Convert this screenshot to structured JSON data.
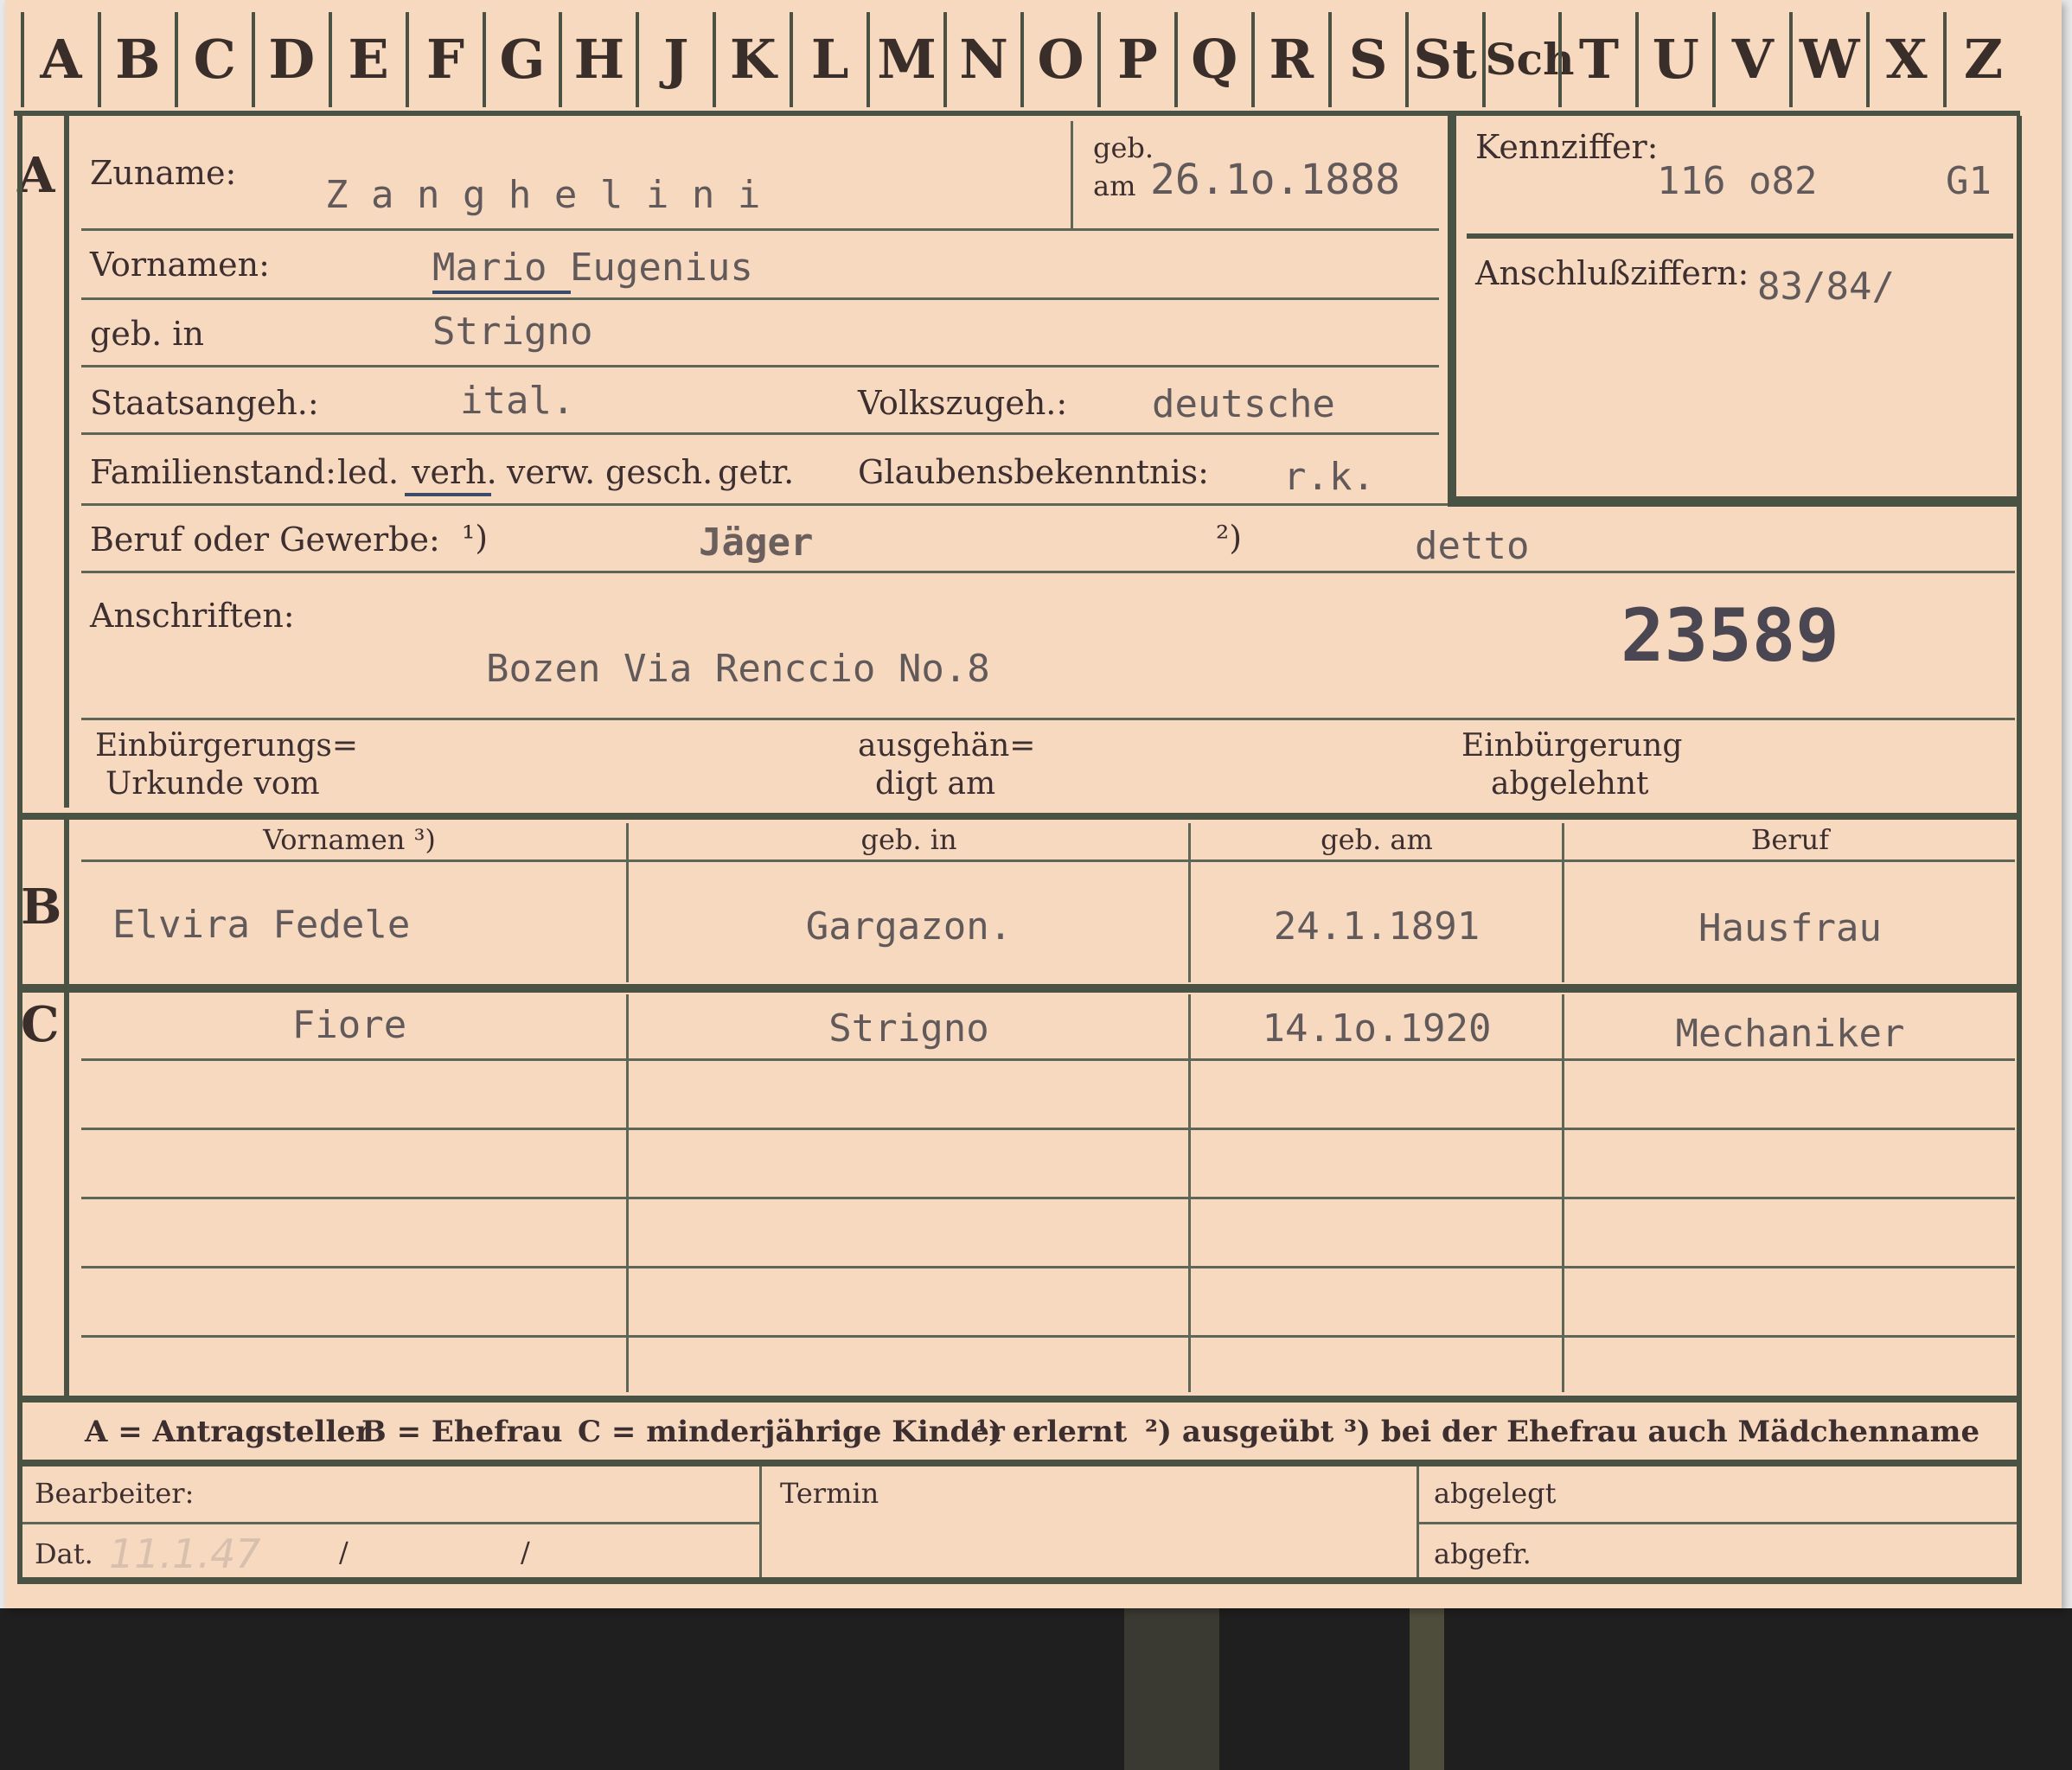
{
  "tabs": [
    "A",
    "B",
    "C",
    "D",
    "E",
    "F",
    "G",
    "H",
    "J",
    "K",
    "L",
    "M",
    "N",
    "O",
    "P",
    "Q",
    "R",
    "S",
    "St",
    "Sch",
    "T",
    "U",
    "V",
    "W",
    "X",
    "Z"
  ],
  "section_a": {
    "letter": "A",
    "zuname_label": "Zuname:",
    "zuname_value": "Z a n g h e l i n i",
    "geb_am_label_1": "geb.",
    "geb_am_label_2": "am",
    "geb_am_value": "26.1o.1888",
    "vornamen_label": "Vornamen:",
    "vornamen_value": "Mario Eugenius",
    "geb_in_label": "geb. in",
    "geb_in_value": "Strigno",
    "staatsangeh_label": "Staatsangeh.:",
    "staatsangeh_value": "ital.",
    "volkszugeh_label": "Volkszugeh.:",
    "volkszugeh_value": "deutsche",
    "familienstand_label": "Familienstand:",
    "familienstand_options": [
      "led.",
      "verh.",
      "verw.",
      "gesch.",
      "getr."
    ],
    "familienstand_selected": "verh.",
    "glaubensbekenntnis_label": "Glaubensbekenntnis:",
    "glaubensbekenntnis_value": "r.k.",
    "kennziffer_label": "Kennziffer:",
    "kennziffer_value": "116 o82",
    "kennziffer_suffix": "G1",
    "anschlussziffern_label": "Anschlußziffern:",
    "anschlussziffern_value": "83/84/",
    "beruf_label": "Beruf oder Gewerbe:",
    "beruf_marker_1": "¹)",
    "beruf_value_1": "Jäger",
    "beruf_marker_2": "²)",
    "beruf_value_2": "detto",
    "anschriften_label": "Anschriften:",
    "anschriften_value": "Bozen  Via Renccio No.8",
    "stamp_number": "23589",
    "einbuergerung_1a": "Einbürgerungs=",
    "einbuergerung_1b": "Urkunde vom",
    "einbuergerung_2a": "ausgehän=",
    "einbuergerung_2b": "digt am",
    "einbuergerung_3a": "Einbürgerung",
    "einbuergerung_3b": "abgelehnt"
  },
  "section_b": {
    "letter": "B",
    "headers": [
      "Vornamen ³)",
      "geb. in",
      "geb. am",
      "Beruf"
    ],
    "row": [
      "Elvira Fedele",
      "Gargazon.",
      "24.1.1891",
      "Hausfrau"
    ]
  },
  "section_c": {
    "letter": "C",
    "row": [
      "Fiore",
      "Strigno",
      "14.1o.1920",
      "Mechaniker"
    ]
  },
  "legend": {
    "a": "A = Antragsteller",
    "b": "B = Ehefrau",
    "c": "C = minderjährige Kinder",
    "n1": "¹) erlernt",
    "n2": "²) ausgeübt",
    "n3": "³) bei der Ehefrau auch Mädchenname"
  },
  "footer": {
    "bearbeiter_label": "Bearbeiter:",
    "dat_label": "Dat.",
    "dat_value": "11.1.47",
    "slash": "/",
    "termin_label": "Termin",
    "abgelegt_label": "abgelegt",
    "abgefr_label": "abgefr."
  },
  "colors": {
    "card": "#f7d9c0",
    "ink_print": "#3d2f30",
    "ink_type": "#625a5a",
    "rules": "#4a5243"
  }
}
